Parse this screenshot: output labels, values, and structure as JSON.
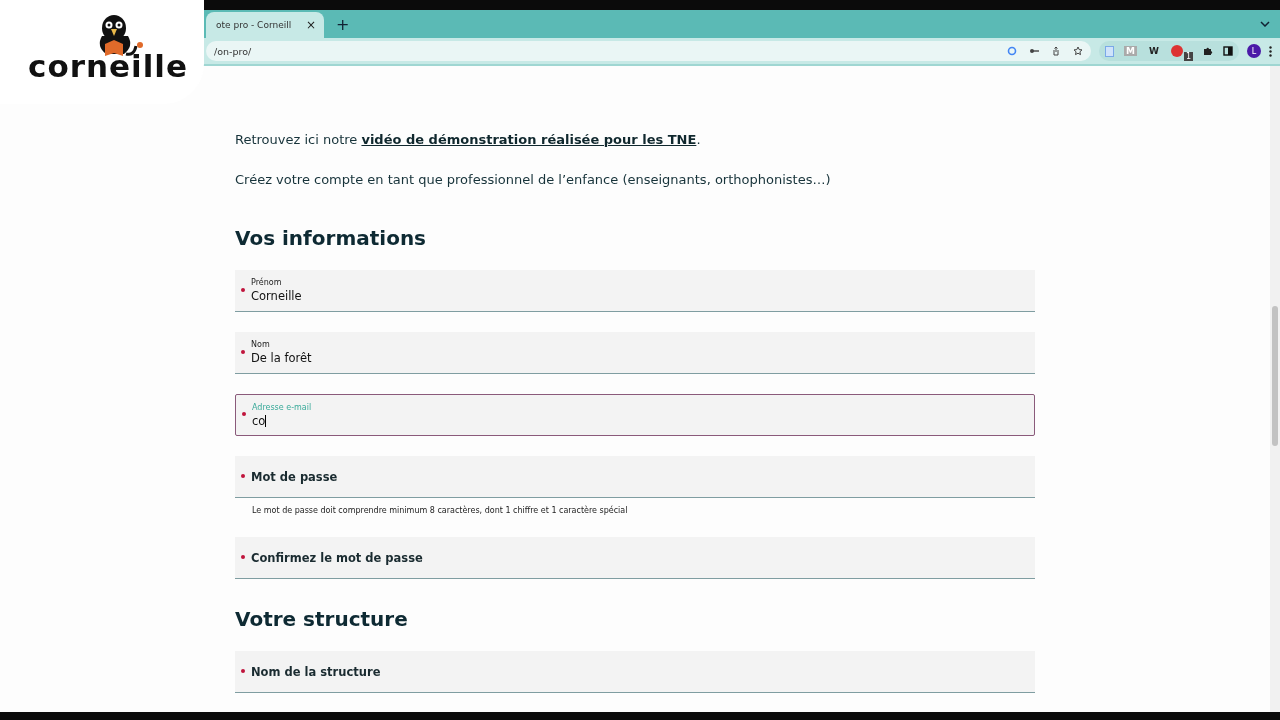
{
  "browser": {
    "tab": {
      "title": "ote pro - Corneill",
      "close": "×"
    },
    "new_tab": "+",
    "address": "/on-pro/",
    "extensions": [
      {
        "kind": "doc"
      },
      {
        "kind": "letter",
        "text": "M"
      },
      {
        "kind": "letter",
        "text": "W"
      },
      {
        "kind": "badge",
        "text": "1"
      },
      {
        "kind": "puzzle"
      },
      {
        "kind": "sidebar"
      }
    ],
    "profile": "L"
  },
  "logo": {
    "text": "corneille"
  },
  "intro": [
    {
      "text": "Retrouvez ici notre ",
      "link": "vidéo de démonstration réalisée pour les TNE",
      "after": "."
    },
    {
      "text": "Créez votre compte en tant que professionnel de l’enfance (enseignants, orthophonistes…)"
    }
  ],
  "sections": [
    {
      "title": "Vos informations",
      "fields": [
        {
          "label": "Prénom",
          "value": "Corneille",
          "focused": false,
          "required": true
        },
        {
          "label": "Nom",
          "value": "De la forêt",
          "focused": false,
          "required": true
        },
        {
          "label": "Adresse e-mail",
          "value": "co",
          "focused": true,
          "required": true
        },
        {
          "placeholder": "Mot de passe",
          "focused": false,
          "required": true,
          "hint": "Le mot de passe doit comprendre minimum 8 caractères, dont 1 chiffre et 1 caractère spécial"
        },
        {
          "placeholder": "Confirmez le mot de passe",
          "focused": false,
          "required": true
        }
      ]
    },
    {
      "title": "Votre structure",
      "fields": [
        {
          "placeholder": "Nom de la structure",
          "focused": false,
          "required": true
        }
      ]
    }
  ]
}
